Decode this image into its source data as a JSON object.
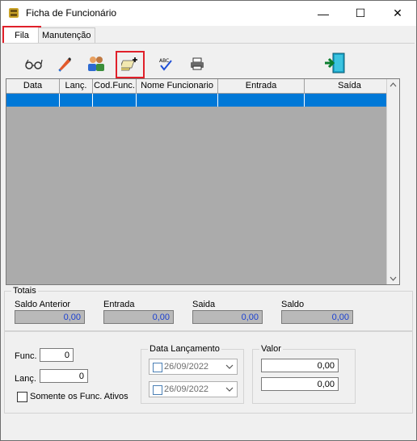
{
  "window": {
    "title": "Ficha de Funcionário",
    "minimize": "—",
    "maximize": "☐",
    "close": "✕"
  },
  "tabs": [
    {
      "label": "Fila"
    },
    {
      "label": "Manutenção"
    }
  ],
  "toolbar": {
    "icons": [
      "glasses-icon",
      "edit-icon",
      "users-icon",
      "add-icon",
      "spellcheck-icon",
      "print-icon",
      "exit-icon"
    ]
  },
  "grid": {
    "columns": [
      "Data",
      "Lanç.",
      "Cod.Func.",
      "Nome Funcionario",
      "Entrada",
      "Saída"
    ]
  },
  "totais": {
    "title": "Totais",
    "saldo_anterior_label": "Saldo Anterior",
    "saldo_anterior": "0,00",
    "entrada_label": "Entrada",
    "entrada": "0,00",
    "saida_label": "Saida",
    "saida": "0,00",
    "saldo_label": "Saldo",
    "saldo": "0,00"
  },
  "filters": {
    "func_label": "Func.",
    "func_value": "0",
    "lanc_label": "Lanç.",
    "lanc_value": "0",
    "somente_label": "Somente os Func. Ativos",
    "data_title": "Data Lançamento",
    "date_from": "26/09/2022",
    "date_to": "26/09/2022",
    "valor_title": "Valor",
    "valor_from": "0,00",
    "valor_to": "0,00"
  },
  "colors": {
    "accent": "#0078d7",
    "highlight": "#e0202a",
    "readonly_value": "#1a3fd0"
  }
}
